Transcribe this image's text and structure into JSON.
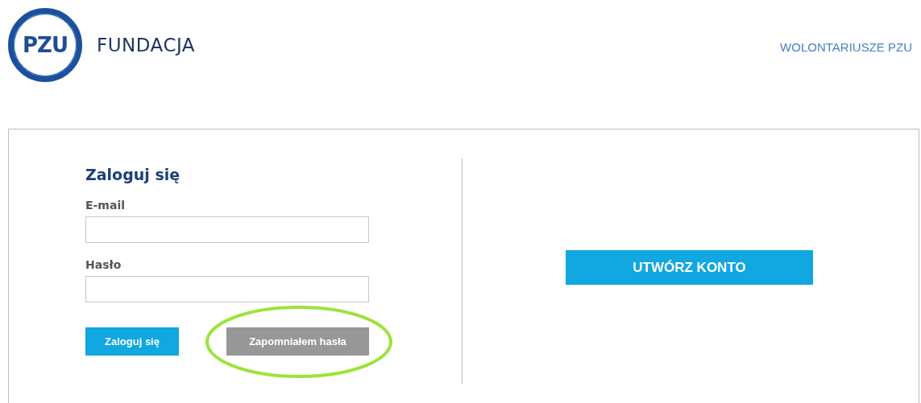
{
  "header": {
    "logo": {
      "mark": "PZU",
      "name": "FUNDACJA"
    },
    "nav_link": "WOLONTARIUSZE PZU"
  },
  "login": {
    "title": "Zaloguj się",
    "fields": [
      {
        "label": "E-mail"
      },
      {
        "label": "Hasło"
      }
    ],
    "buttons": [
      {
        "label": "Zaloguj się",
        "kind": "primary",
        "highlighted": false
      },
      {
        "label": "Zapomniałem hasła",
        "kind": "secondary",
        "highlighted": true
      }
    ]
  },
  "register": {
    "button": "UTWÓRZ KONTO"
  }
}
